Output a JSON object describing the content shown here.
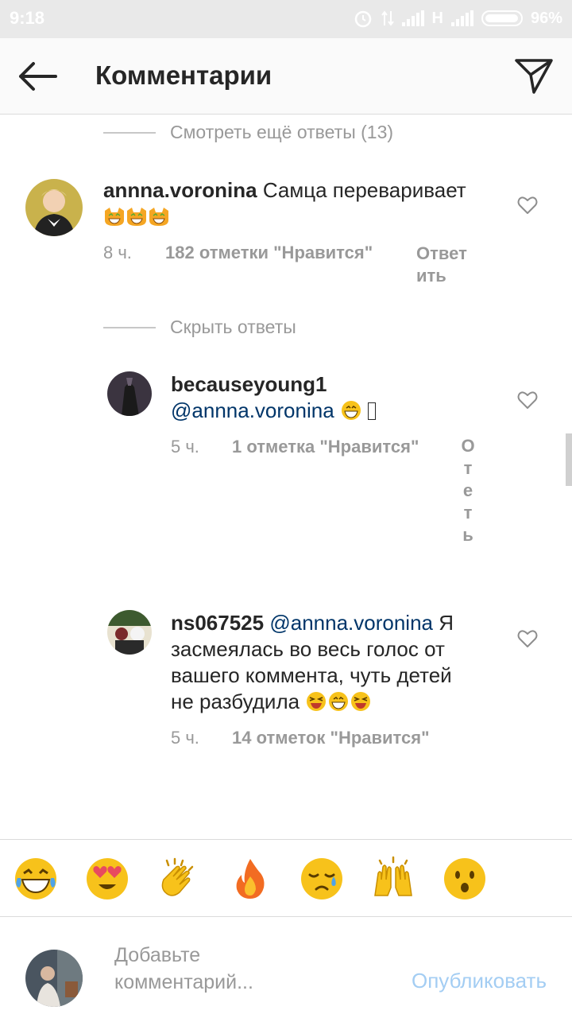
{
  "status": {
    "time": "9:18",
    "network": "H",
    "battery": "96%"
  },
  "header": {
    "title": "Комментарии"
  },
  "view_more": "Смотреть ещё ответы (13)",
  "hide_replies": "Скрыть ответы",
  "comments": [
    {
      "username": "annna.voronina",
      "text": "Самца переваривает",
      "emojis": [
        "laughing-cat-emoji",
        "laughing-cat-emoji",
        "laughing-cat-emoji"
      ],
      "time": "8 ч.",
      "likes": "182 отметки \"Нравится\"",
      "reply_line1": "Ответ",
      "reply_line2": "ить"
    },
    {
      "username": "becauseyoung1",
      "mention": "@annna.voronina",
      "emojis": [
        "grinning-emoji"
      ],
      "time": "5 ч.",
      "likes": "1 отметка \"Нравится\"",
      "reply_chars": [
        "О",
        "т",
        "е",
        "т",
        "ь"
      ]
    },
    {
      "username": "ns067525",
      "mention": "@annna.voronina",
      "text_line1": "Я",
      "text_line2": "засмеялась во весь голос от",
      "text_line3": "вашего коммента, чуть детей",
      "text_line4": "не разбудила",
      "emojis": [
        "laughing-squint-emoji",
        "grinning-emoji",
        "laughing-squint-emoji"
      ],
      "time": "5 ч.",
      "likes": "14 отметок \"Нравится\""
    }
  ],
  "emoji_bar": [
    "tears-of-joy",
    "heart-eyes",
    "clapping-hands",
    "fire",
    "sad",
    "raised-hands",
    "surprised"
  ],
  "input": {
    "placeholder_line1": "Добавьте",
    "placeholder_line2": "комментарий...",
    "publish": "Опубликовать"
  },
  "colors": {
    "mention": "#003569",
    "muted": "#999999",
    "publish": "#a3cdf3",
    "emoji": "#f7c21b"
  }
}
